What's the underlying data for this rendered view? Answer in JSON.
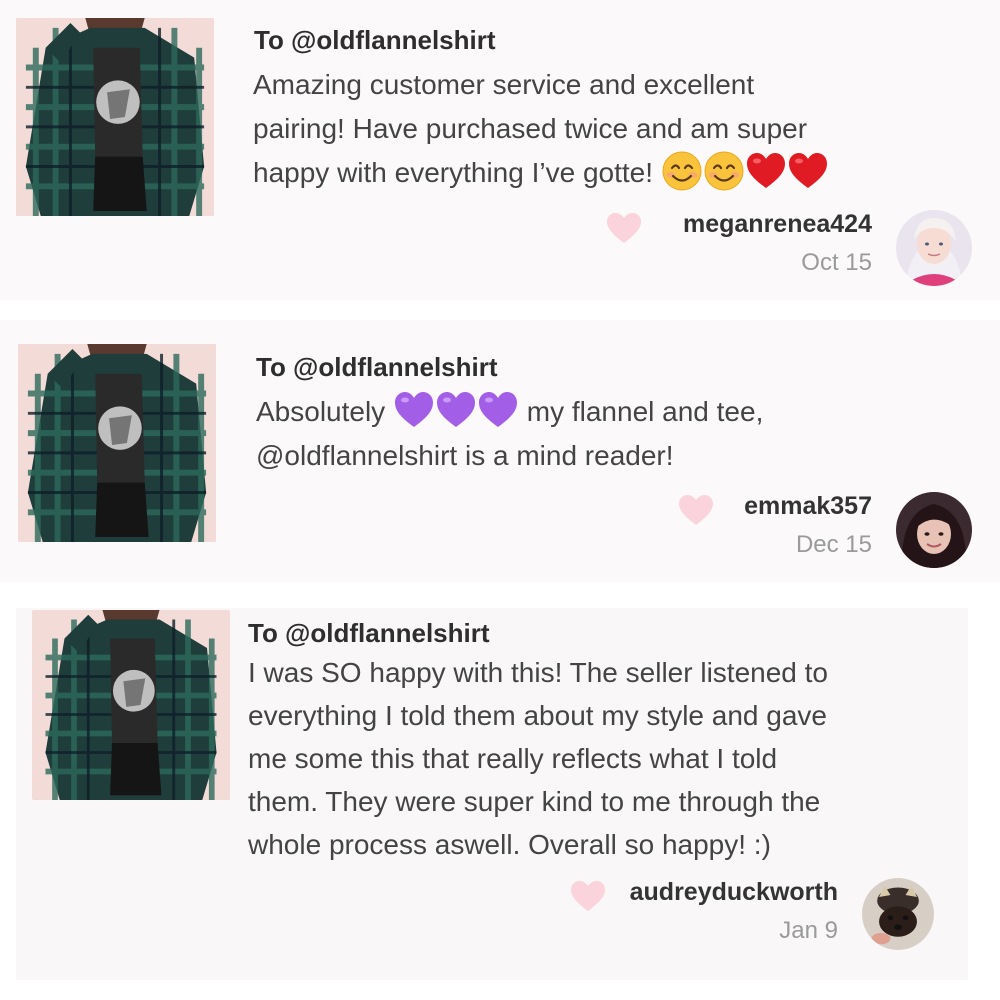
{
  "reviews": [
    {
      "to": "To @oldflannelshirt",
      "lines": [
        "Amazing customer service and excellent",
        "pairing! Have purchased twice and am super",
        "happy with everything I’ve gotte!"
      ],
      "emojis": [
        "smiling-face-icon",
        "smiling-face-icon",
        "red-heart-icon",
        "red-heart-icon"
      ],
      "username": "meganrenea424",
      "date": "Oct 15"
    },
    {
      "to": "To @oldflannelshirt",
      "line1_before": "Absolutely",
      "line1_after": "my flannel and tee,",
      "line2": "@oldflannelshirt is a mind reader!",
      "emojis": [
        "purple-heart-icon",
        "purple-heart-icon",
        "purple-heart-icon"
      ],
      "username": "emmak357",
      "date": "Dec 15"
    },
    {
      "to": "To @oldflannelshirt",
      "lines": [
        "I was SO happy with this! The seller listened to",
        "everything I told them about my style and gave",
        "me some this that really reflects what I told",
        "them. They were super kind to me through the",
        "whole process aswell. Overall so happy! :)"
      ],
      "username": "audreyduckworth",
      "date": "Jan 9"
    }
  ],
  "colors": {
    "like_heart": "#fbd3dc",
    "red_heart": "#e01b24",
    "purple_heart": "#a35ee8",
    "emoji_face": "#f9c43b",
    "date_gray": "#9a9a9a"
  }
}
